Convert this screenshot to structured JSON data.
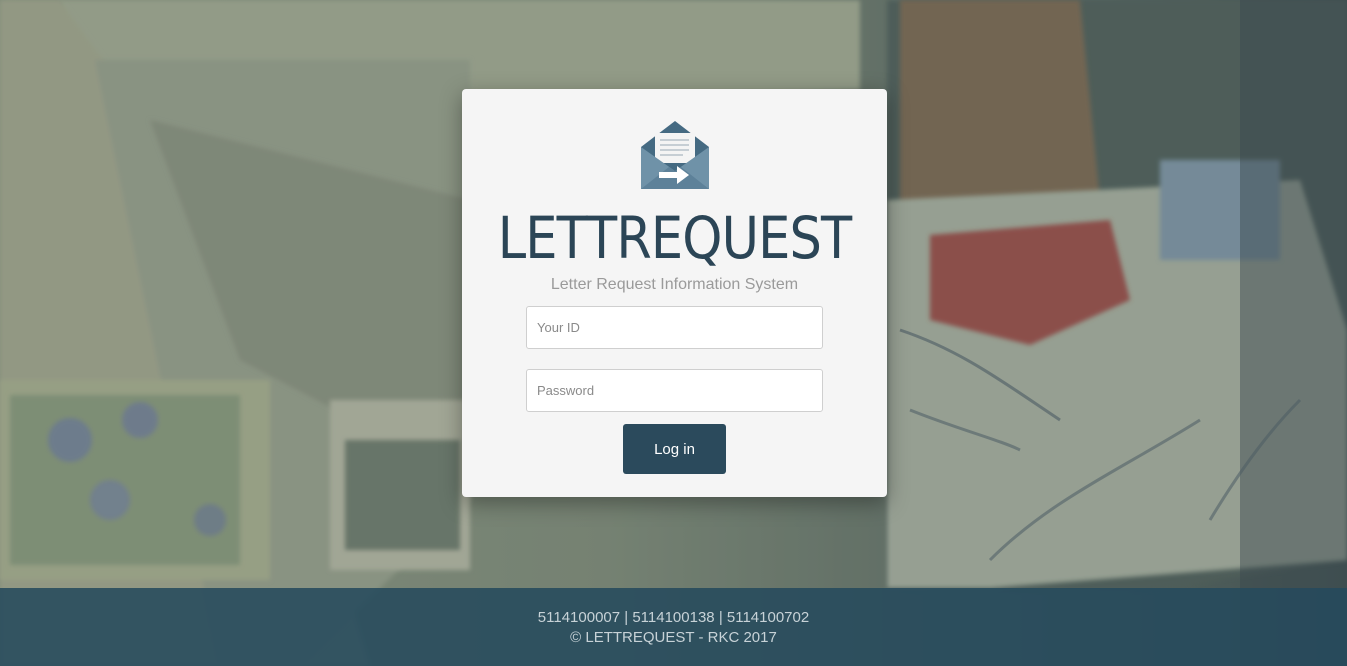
{
  "brand": {
    "name": "LETTREQUEST",
    "tagline": "Letter Request Information System",
    "logo_icon": "envelope-letter-icon"
  },
  "form": {
    "id_placeholder": "Your ID",
    "id_value": "",
    "password_placeholder": "Password",
    "password_value": "",
    "login_label": "Log in"
  },
  "footer": {
    "ids": "5114100007 | 5114100138 | 5114100702",
    "copyright": "© LETTREQUEST - RKC 2017"
  },
  "colors": {
    "primary": "#2b4a5c",
    "footer_bg": "#264a5c",
    "card_bg": "#f5f5f5"
  }
}
